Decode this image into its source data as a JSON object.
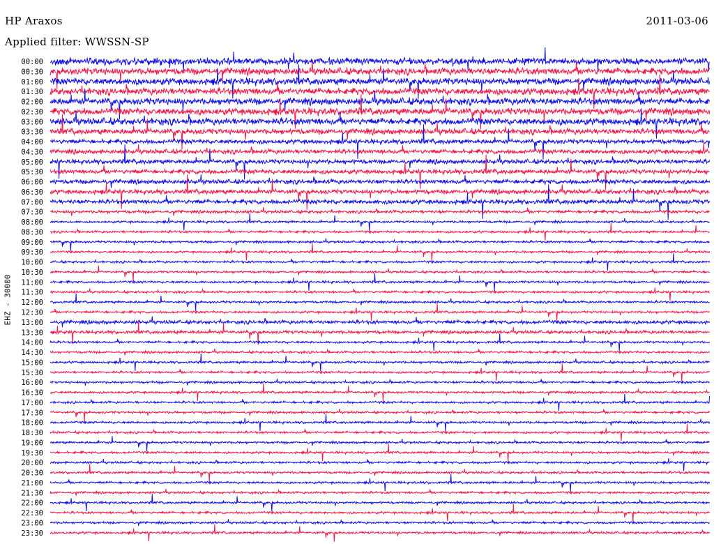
{
  "header": {
    "station": "HP Araxos",
    "date": "2011-03-06",
    "filter": "Applied filter: WWSSN-SP"
  },
  "station_label": "EHZ - 30000",
  "colors": {
    "line_a": "#1010e8",
    "line_b": "#f01848",
    "background": "#ffffff",
    "text": "#000000"
  },
  "chart_data": {
    "type": "line",
    "title": "HP Araxos",
    "subtitle": "Applied filter: WWSSN-SP",
    "ylabel": "EHZ - 30000",
    "xlabel": "",
    "row_labels": [
      "00:00",
      "00:30",
      "01:00",
      "01:30",
      "02:00",
      "02:30",
      "03:00",
      "03:30",
      "04:00",
      "04:30",
      "05:00",
      "05:30",
      "06:00",
      "06:30",
      "07:00",
      "07:30",
      "08:00",
      "08:30",
      "09:00",
      "09:30",
      "10:00",
      "10:30",
      "11:00",
      "11:30",
      "12:00",
      "12:30",
      "13:00",
      "13:30",
      "14:00",
      "14:30",
      "15:00",
      "15:30",
      "16:00",
      "16:30",
      "17:00",
      "17:30",
      "18:00",
      "18:30",
      "19:00",
      "19:30",
      "20:00",
      "20:30",
      "21:00",
      "21:30",
      "22:00",
      "22:30",
      "23:00",
      "23:30"
    ],
    "row_amplitude": [
      3,
      3,
      3,
      3,
      3,
      3,
      3,
      2.5,
      2,
      2,
      2,
      2,
      2,
      2,
      2,
      1.3,
      1,
      1,
      1,
      1,
      1,
      1,
      1,
      1,
      1,
      1,
      1.6,
      1.4,
      1,
      1,
      1,
      1,
      1,
      1,
      1,
      1,
      1,
      1,
      1,
      1,
      1,
      1,
      1,
      1,
      1,
      1,
      1,
      1
    ],
    "row_colors": [
      "blue",
      "red"
    ],
    "x_minutes": [
      0,
      30
    ],
    "grid": false,
    "legend": "none"
  }
}
